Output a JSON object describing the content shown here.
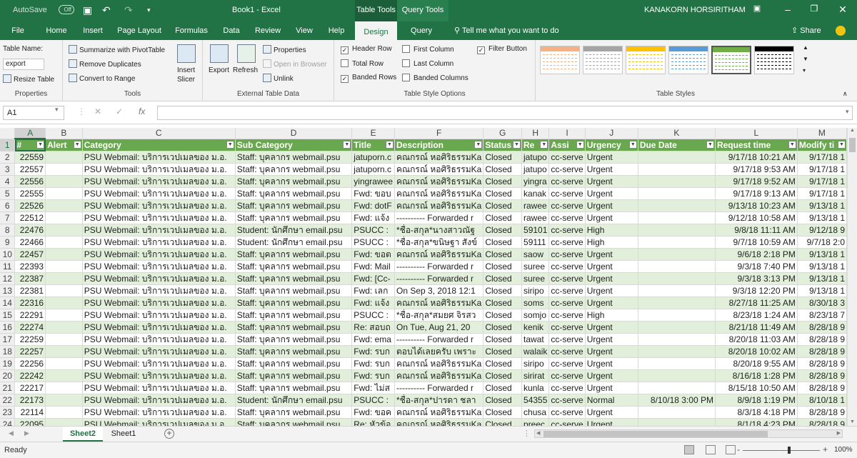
{
  "titlebar": {
    "autosave": "AutoSave",
    "autosave_state": "Off",
    "doc_title": "Book1 - Excel",
    "context_tab_table": "Table Tools",
    "context_tab_query": "Query Tools",
    "user": "KANAKORN HORSIRITHAM"
  },
  "tabs": [
    "File",
    "Home",
    "Insert",
    "Page Layout",
    "Formulas",
    "Data",
    "Review",
    "View",
    "Help",
    "Design",
    "Query"
  ],
  "active_tab": "Design",
  "tell_me": "Tell me what you want to do",
  "share": "Share",
  "ribbon": {
    "properties": {
      "table_name_label": "Table Name:",
      "table_name": "export",
      "resize": "Resize Table",
      "label": "Properties"
    },
    "tools": {
      "summarize": "Summarize with PivotTable",
      "remove_dup": "Remove Duplicates",
      "convert": "Convert to Range",
      "insert_slicer_1": "Insert",
      "insert_slicer_2": "Slicer",
      "label": "Tools"
    },
    "external": {
      "export": "Export",
      "refresh": "Refresh",
      "properties": "Properties",
      "open_browser": "Open in Browser",
      "unlink": "Unlink",
      "label": "External Table Data"
    },
    "style_options": {
      "header_row": "Header Row",
      "total_row": "Total Row",
      "banded_rows": "Banded Rows",
      "first_column": "First Column",
      "last_column": "Last Column",
      "banded_columns": "Banded Columns",
      "filter_button": "Filter Button",
      "label": "Table Style Options",
      "checked": {
        "header_row": true,
        "total_row": false,
        "banded_rows": true,
        "first_column": false,
        "last_column": false,
        "banded_columns": false,
        "filter_button": true
      }
    },
    "table_styles": {
      "label": "Table Styles",
      "swatches": [
        "#f4b183",
        "#a5a5a5",
        "#ffc000",
        "#5b9bd5",
        "#70ad47",
        "#000000"
      ]
    }
  },
  "formula_bar": {
    "name_box": "A1",
    "fx": "fx",
    "cancel": "✕",
    "enter": "✓",
    "formula": ""
  },
  "columns": [
    "A",
    "B",
    "C",
    "D",
    "E",
    "F",
    "G",
    "H",
    "I",
    "J",
    "K",
    "L",
    "M"
  ],
  "table_headers": [
    "#",
    "Alert",
    "Category",
    "Sub Category",
    "Title",
    "Description",
    "Status",
    "Re",
    "Assi",
    "Urgency",
    "Due Date",
    "Request time",
    "Modify ti"
  ],
  "rows": [
    [
      "22559",
      "",
      "PSU Webmail: บริการเวปเมลของ ม.อ.",
      "Staff: บุคลากร webmail.psu",
      "jatuporn.c",
      "คณกรณ์ หอศิริธรรมKa",
      "Closed",
      "jatupo",
      "cc-serve",
      "Urgent",
      "",
      "9/17/18 10:21 AM",
      "9/17/18 1"
    ],
    [
      "22557",
      "",
      "PSU Webmail: บริการเวปเมลของ ม.อ.",
      "Staff: บุคลากร webmail.psu",
      "jatuporn.c",
      "คณกรณ์ หอศิริธรรมKa",
      "Closed",
      "jatupo",
      "cc-serve",
      "Urgent",
      "",
      "9/17/18 9:53 AM",
      "9/17/18 1"
    ],
    [
      "22556",
      "",
      "PSU Webmail: บริการเวปเมลของ ม.อ.",
      "Staff: บุคลากร webmail.psu",
      "yingrawee",
      "คณกรณ์ หอศิริธรรมKa",
      "Closed",
      "yingra",
      "cc-serve",
      "Urgent",
      "",
      "9/17/18 9:52 AM",
      "9/17/18 1"
    ],
    [
      "22555",
      "",
      "PSU Webmail: บริการเวปเมลของ ม.อ.",
      "Staff: บุคลากร webmail.psu",
      "Fwd: ขอบ",
      "คณกรณ์ หอศิริธรรมKa",
      "Closed",
      "kanak",
      "cc-serve",
      "Urgent",
      "",
      "9/17/18 9:13 AM",
      "9/17/18 1"
    ],
    [
      "22526",
      "",
      "PSU Webmail: บริการเวปเมลของ ม.อ.",
      "Staff: บุคลากร webmail.psu",
      "Fwd: dotF",
      "คณกรณ์ หอศิริธรรมKa",
      "Closed",
      "rawee",
      "cc-serve",
      "Urgent",
      "",
      "9/13/18 10:23 AM",
      "9/13/18 1"
    ],
    [
      "22512",
      "",
      "PSU Webmail: บริการเวปเมลของ ม.อ.",
      "Staff: บุคลากร webmail.psu",
      "Fwd: แจ้ง",
      "---------- Forwarded r",
      "Closed",
      "rawee",
      "cc-serve",
      "Urgent",
      "",
      "9/12/18 10:58 AM",
      "9/13/18 1"
    ],
    [
      "22476",
      "",
      "PSU Webmail: บริการเวปเมลของ ม.อ.",
      "Student: นักศึกษา email.psu",
      "PSUCC : ",
      "*ชื่อ-สกุล*นางสาวณัฐ",
      "Closed",
      "59101",
      "cc-serve",
      "High",
      "",
      "9/8/18 11:11 AM",
      "9/12/18 9"
    ],
    [
      "22466",
      "",
      "PSU Webmail: บริการเวปเมลของ ม.อ.",
      "Student: นักศึกษา email.psu",
      "PSUCC : ",
      "*ชื่อ-สกุล*ขนิษฐา สังข์",
      "Closed",
      "59111",
      "cc-serve",
      "High",
      "",
      "9/7/18 10:59 AM",
      "9/7/18 2:0"
    ],
    [
      "22457",
      "",
      "PSU Webmail: บริการเวปเมลของ ม.อ.",
      "Staff: บุคลากร webmail.psu",
      "Fwd: ขอต",
      "คณกรณ์ หอศิริธรรมKa",
      "Closed",
      "saow",
      "cc-serve",
      "Urgent",
      "",
      "9/6/18 2:18 PM",
      "9/13/18 1"
    ],
    [
      "22393",
      "",
      "PSU Webmail: บริการเวปเมลของ ม.อ.",
      "Staff: บุคลากร webmail.psu",
      "Fwd: Mail",
      "---------- Forwarded r",
      "Closed",
      "suree",
      "cc-serve",
      "Urgent",
      "",
      "9/3/18 7:40 PM",
      "9/13/18 1"
    ],
    [
      "22387",
      "",
      "PSU Webmail: บริการเวปเมลของ ม.อ.",
      "Staff: บุคลากร webmail.psu",
      "Fwd: [Cc-",
      "---------- Forwarded r",
      "Closed",
      "suree",
      "cc-serve",
      "Urgent",
      "",
      "9/3/18 3:13 PM",
      "9/13/18 1"
    ],
    [
      "22381",
      "",
      "PSU Webmail: บริการเวปเมลของ ม.อ.",
      "Staff: บุคลากร webmail.psu",
      "Fwd: เลก",
      "On Sep 3, 2018 12:1",
      "Closed",
      "siripo",
      "cc-serve",
      "Urgent",
      "",
      "9/3/18 12:20 PM",
      "9/13/18 1"
    ],
    [
      "22316",
      "",
      "PSU Webmail: บริการเวปเมลของ ม.อ.",
      "Staff: บุคลากร webmail.psu",
      "Fwd: แจ้ง",
      "คณกรณ์ หอศิริธรรมKa",
      "Closed",
      "soms",
      "cc-serve",
      "Urgent",
      "",
      "8/27/18 11:25 AM",
      "8/30/18 3"
    ],
    [
      "22291",
      "",
      "PSU Webmail: บริการเวปเมลของ ม.อ.",
      "Staff: บุคลากร webmail.psu",
      "PSUCC : ",
      "*ชื่อ-สกุล*สมยศ จิรสว",
      "Closed",
      "somjo",
      "cc-serve",
      "High",
      "",
      "8/23/18 1:24 AM",
      "8/23/18 7"
    ],
    [
      "22274",
      "",
      "PSU Webmail: บริการเวปเมลของ ม.อ.",
      "Staff: บุคลากร webmail.psu",
      "Re: สอบถ",
      "On Tue, Aug 21, 20",
      "Closed",
      "kenik",
      "cc-serve",
      "Urgent",
      "",
      "8/21/18 11:49 AM",
      "8/28/18 9"
    ],
    [
      "22259",
      "",
      "PSU Webmail: บริการเวปเมลของ ม.อ.",
      "Staff: บุคลากร webmail.psu",
      "Fwd: ema",
      "---------- Forwarded r",
      "Closed",
      "tawat",
      "cc-serve",
      "Urgent",
      "",
      "8/20/18 11:03 AM",
      "8/28/18 9"
    ],
    [
      "22257",
      "",
      "PSU Webmail: บริการเวปเมลของ ม.อ.",
      "Staff: บุคลากร webmail.psu",
      "Fwd: รบก",
      "ตอบได้เลยครับ เพราะ",
      "Closed",
      "walaik",
      "cc-serve",
      "Urgent",
      "",
      "8/20/18 10:02 AM",
      "8/28/18 9"
    ],
    [
      "22256",
      "",
      "PSU Webmail: บริการเวปเมลของ ม.อ.",
      "Staff: บุคลากร webmail.psu",
      "Fwd: รบก",
      "คณกรณ์ หอศิริธรรมKa",
      "Closed",
      "siripo",
      "cc-serve",
      "Urgent",
      "",
      "8/20/18 9:55 AM",
      "8/28/18 9"
    ],
    [
      "22242",
      "",
      "PSU Webmail: บริการเวปเมลของ ม.อ.",
      "Staff: บุคลากร webmail.psu",
      "Fwd: รบก",
      "คณกรณ์ หอศิริธรรมKa",
      "Closed",
      "sirirat",
      "cc-serve",
      "Urgent",
      "",
      "8/16/18 1:28 PM",
      "8/28/18 9"
    ],
    [
      "22217",
      "",
      "PSU Webmail: บริการเวปเมลของ ม.อ.",
      "Staff: บุคลากร webmail.psu",
      "Fwd: ไม่ส",
      "---------- Forwarded r",
      "Closed",
      "kunla",
      "cc-serve",
      "Urgent",
      "",
      "8/15/18 10:50 AM",
      "8/28/18 9"
    ],
    [
      "22173",
      "",
      "PSU Webmail: บริการเวปเมลของ ม.อ.",
      "Student: นักศึกษา email.psu",
      "PSUCC : ",
      "*ชื่อ-สกุล*ปารดา ชลา",
      "Closed",
      "54355",
      "cc-serve",
      "Normal",
      "8/10/18 3:00 PM",
      "8/9/18 1:19 PM",
      "8/10/18 1"
    ],
    [
      "22114",
      "",
      "PSU Webmail: บริการเวปเมลของ ม.อ.",
      "Staff: บุคลากร webmail.psu",
      "Fwd: ขอค",
      "คณกรณ์ หอศิริธรรมKa",
      "Closed",
      "chusa",
      "cc-serve",
      "Urgent",
      "",
      "8/3/18 4:18 PM",
      "8/28/18 9"
    ],
    [
      "22095",
      "",
      "PSU Webmail: บริการเวปเมลของ ม.อ.",
      "Staff: บุคลากร webmail.psu",
      "Re: หัวข้อ",
      "คณกรณ์ หอศิริธรรมKa",
      "Closed",
      "preec",
      "cc-serve",
      "Urgent",
      "",
      "8/1/18 4:23 PM",
      "8/28/18 9"
    ]
  ],
  "sheets": [
    "Sheet2",
    "Sheet1"
  ],
  "active_sheet": "Sheet2",
  "status": {
    "ready": "Ready",
    "zoom": "100%",
    "minus": "-",
    "plus": "+"
  },
  "colors": {
    "excel_green": "#217346",
    "table_header": "#6aa84f",
    "band": "#e2efda"
  }
}
